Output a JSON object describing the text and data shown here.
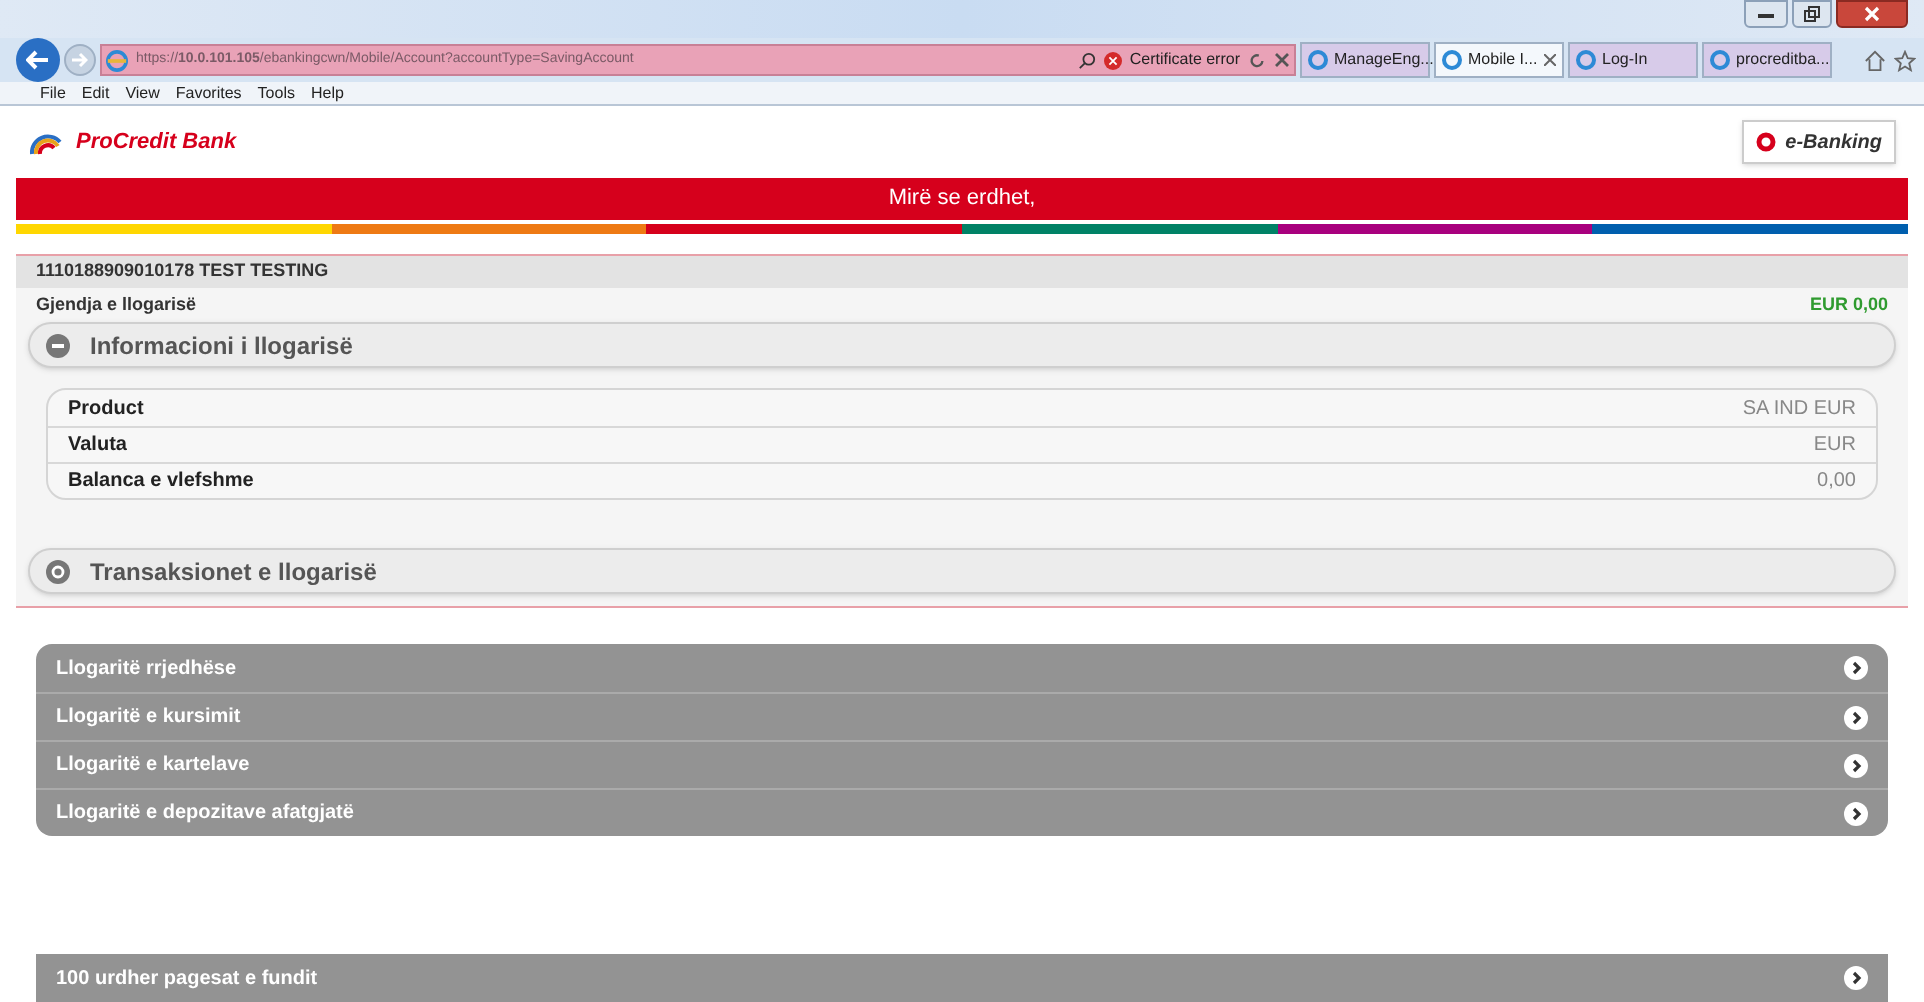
{
  "browser": {
    "address": "https://**10.0.101.105**/ebankingcwn/Mobile/Account?accountType=SavingAccount",
    "certificate_error": "Certificate error",
    "tabs": [
      {
        "label": "ManageEng...",
        "selected": false
      },
      {
        "label": "Mobile I...",
        "selected": true
      },
      {
        "label": "Log-In",
        "selected": false
      },
      {
        "label": "procreditba...",
        "selected": false
      }
    ],
    "menu": [
      "File",
      "Edit",
      "View",
      "Favorites",
      "Tools",
      "Help"
    ]
  },
  "header": {
    "logo_text": "ProCredit Bank",
    "ebanking_button": "e-Banking",
    "welcome": "Mirë se erdhet,"
  },
  "account": {
    "title": "1110188909010178 TEST TESTING",
    "balance_label": "Gjendja e llogarisë",
    "balance": "EUR 0,00",
    "sections": [
      {
        "title": "Informacioni i llogarisë",
        "expanded": true,
        "rows": [
          {
            "label": "Product",
            "value": "SA IND EUR"
          },
          {
            "label": "Valuta",
            "value": "EUR"
          },
          {
            "label": "Balanca e vlefshme",
            "value": "0,00"
          }
        ]
      },
      {
        "title": "Transaksionet e llogarisë",
        "expanded": false
      }
    ]
  },
  "account_types": [
    "Llogaritë rrjedhëse",
    "Llogaritë e kursimit",
    "Llogaritë e kartelave",
    "Llogaritë e depozitave afatgjatë"
  ],
  "recent_payments": "100 urdher pagesat e fundit"
}
